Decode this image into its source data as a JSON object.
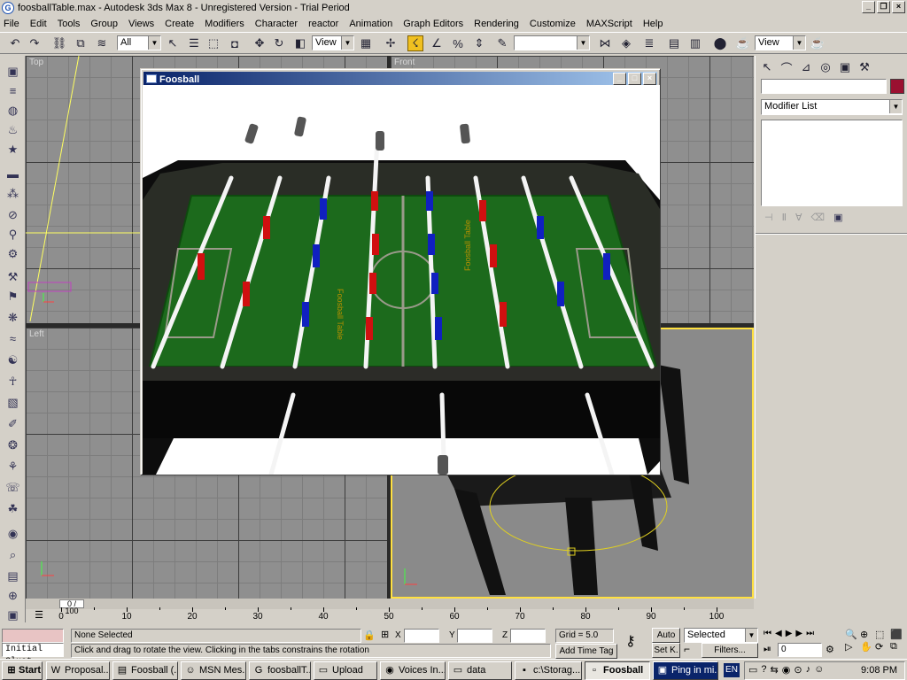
{
  "window": {
    "title": "foosballTable.max - Autodesk 3ds Max 8  -  Unregistered Version  -  Trial Period",
    "app_icon": "3dsmax-icon"
  },
  "menu": [
    "File",
    "Edit",
    "Tools",
    "Group",
    "Views",
    "Create",
    "Modifiers",
    "Character",
    "reactor",
    "Animation",
    "Graph Editors",
    "Rendering",
    "Customize",
    "MAXScript",
    "Help"
  ],
  "toolbar": {
    "filter_value": "All",
    "refcoord_value": "View",
    "selset_value": "",
    "view2_value": "View"
  },
  "viewports": {
    "top_label": "Top",
    "front_label": "Front",
    "left_label": "Left",
    "persp_label": ""
  },
  "foosball_window": {
    "title": "Foosball",
    "logo_text": "Foosball Table"
  },
  "command_panel": {
    "name_value": "",
    "modifier_list": "Modifier List",
    "color_swatch": "#9a1030"
  },
  "timeline": {
    "frame_readout": "0 / 100",
    "ticks": [
      "0",
      "10",
      "20",
      "30",
      "40",
      "50",
      "60",
      "70",
      "80",
      "90",
      "100"
    ]
  },
  "status": {
    "selection": "None Selected",
    "prompt": "Click and drag to rotate the view.  Clicking in the tabs constrains the rotation",
    "x_label": "X",
    "y_label": "Y",
    "z_label": "Z",
    "x_value": "",
    "y_value": "",
    "z_value": "",
    "grid": "Grid = 5.0",
    "add_time_tag": "Add Time Tag",
    "auto_key": "Auto",
    "set_key": "Set K.",
    "key_mode": "Selected",
    "filters": "Filters...",
    "frame_value": "0",
    "maxscript_listener": "Initial Clust"
  },
  "taskbar": {
    "start": "Start",
    "tasks": [
      {
        "label": "Proposal....",
        "icon": "W"
      },
      {
        "label": "Foosball (...",
        "icon": "▤"
      },
      {
        "label": "MSN Mes...",
        "icon": "☺"
      },
      {
        "label": "foosballT...",
        "icon": "G"
      },
      {
        "label": "Upload",
        "icon": "▭"
      },
      {
        "label": "Voices In...",
        "icon": "◉"
      },
      {
        "label": "data",
        "icon": "▭"
      },
      {
        "label": "c:\\Storag...",
        "icon": "▪"
      },
      {
        "label": "Foosball",
        "icon": "▫"
      },
      {
        "label": "Ping in mi...",
        "icon": "▣"
      }
    ],
    "language": "EN",
    "clock": "9:08 PM"
  }
}
